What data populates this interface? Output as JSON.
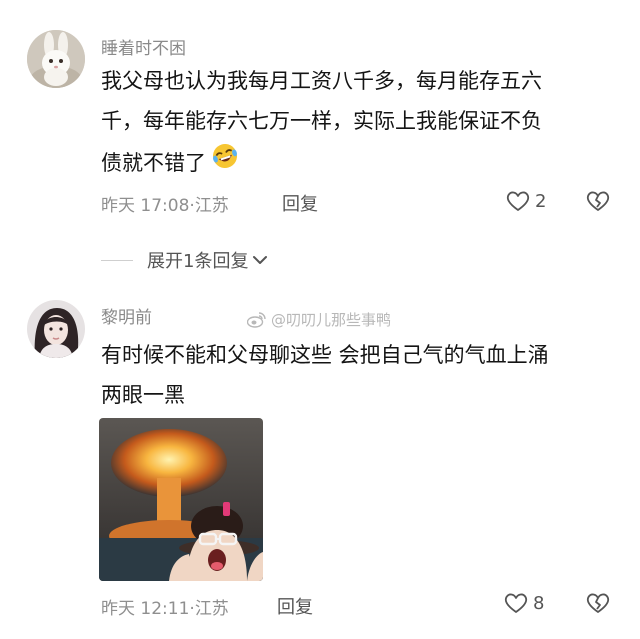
{
  "comments": [
    {
      "username": "睡着时不困",
      "lines": [
        "我父母也认为我每月工资八千多，每月能存五六",
        "千，每年能存六七万一样，实际上我能保证不负",
        "债就不错了"
      ],
      "emoji_icon": "rofl-emoji-icon",
      "time": "昨天 17:08",
      "location": "江苏",
      "reply_label": "回复",
      "like_count": "2",
      "expand_label": "展开1条回复"
    },
    {
      "username": "黎明前",
      "lines": [
        "有时候不能和父母聊这些 会把自己气的气血上涌",
        "两眼一黑"
      ],
      "image_icon": "explosion-meme-image",
      "time": "昨天 12:11",
      "location": "江苏",
      "reply_label": "回复",
      "like_count": "8"
    }
  ],
  "watermark": {
    "text": "@叨叨儿那些事鸭",
    "icon": "weibo-logo-icon"
  },
  "colors": {
    "meta_gray": "#8f8f8f",
    "text_dark": "#141414",
    "icon_gray": "#555555"
  }
}
